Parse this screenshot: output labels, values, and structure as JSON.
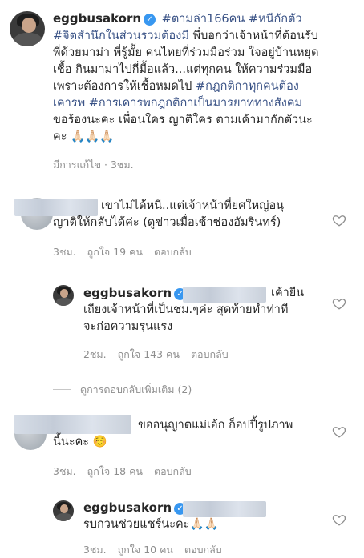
{
  "caption": {
    "username": "eggbusakorn",
    "lines": [
      {
        "hashtag": " #ตามล่า166คน #หนีกักตัว"
      },
      {
        "hashtag": "#จิตสำนึกในส่วนรวมต้องมี",
        "text": " พี่บอกว่าเจ้าหน้าที่ต้อนรับ"
      },
      {
        "text": "พี่ด้วยมาม่า พี่รู้มั้ย คนไทยที่ร่วมมือร่วม ใจอยู่บ้านหยุด"
      },
      {
        "text": "เชื้อ กินมาม่าไปกี่มื้อแล้ว...แต่ทุกคน ให้ความร่วมมือ"
      },
      {
        "text": "เพราะต้องการให้เชื้อหมดไป ",
        "hashtag": "#กฎกติกาทุกคนต้อง"
      },
      {
        "hashtag": "เคารพ #การเคารพกฎกติกาเป็นมารยาททางสังคม"
      },
      {
        "text": "ขอร้องนะคะ เพื่อนใคร ญาติใคร ตามเค้ามากักตัวนะ"
      },
      {
        "text": "คะ 🙏🏻🙏🏻🙏🏻"
      }
    ],
    "edited": "มีการแก้ไข",
    "time": "3ชม."
  },
  "comments": [
    {
      "line1": "เขาไม่ได้หนี..แต่เจ้าหน้าที่ยศใหญ่อนุ",
      "line2": "ญาติให้กลับได้ค่ะ (ดูข่าวเมื่อเช้าช่องอัมรินทร์)",
      "time": "3ชม.",
      "likes": "ถูกใจ 19 คน",
      "reply": "ตอบกลับ"
    },
    {
      "username": "eggbusakorn",
      "line1": "เค้ายืน",
      "line2": "เถียงเจ้าหน้าที่เป็นชม.ๆค่ะ สุดท้ายทำท่าที",
      "line3": "จะก่อความรุนแรง",
      "time": "2ชม.",
      "likes": "ถูกใจ 143 คน",
      "reply": "ตอบกลับ"
    },
    {
      "line1": "ขออนุญาตแม่เอ้ก ก็อปปี้รูปภาพ",
      "line2": "นี้นะคะ ☺️",
      "time": "3ชม.",
      "likes": "ถูกใจ 18 คน",
      "reply": "ตอบกลับ"
    },
    {
      "username": "eggbusakorn",
      "line1": "รบกวนช่วยแชร์นะคะ🙏🏻🙏🏻",
      "time": "3ชม.",
      "likes": "ถูกใจ 10 คน",
      "reply": "ตอบกลับ"
    }
  ],
  "view_more_replies": "ดูการตอบกลับเพิ่มเติม (2)",
  "icons": {
    "verified": "✓",
    "heart": "heart-icon"
  },
  "colors": {
    "hashtag": "#385185",
    "verified": "#3897f0",
    "meta": "#8e8e8e"
  }
}
